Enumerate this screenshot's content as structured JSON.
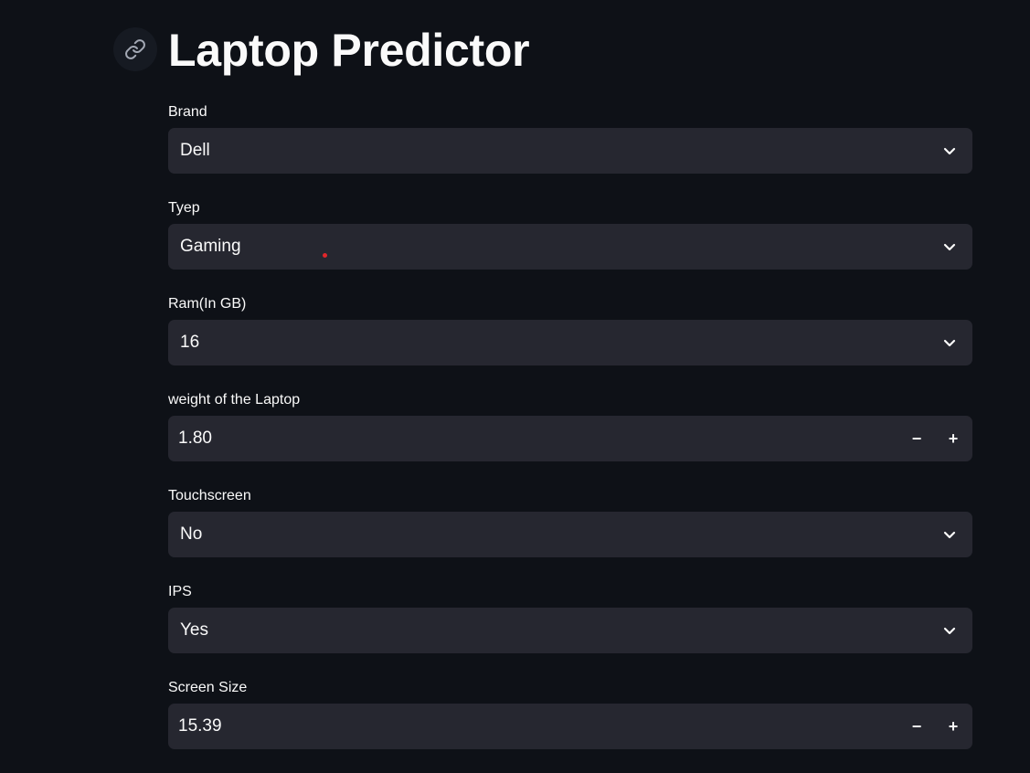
{
  "page": {
    "title": "Laptop Predictor",
    "anchor_icon": "link-icon"
  },
  "fields": {
    "brand": {
      "label": "Brand",
      "value": "Dell",
      "icon": "chevron-down-icon"
    },
    "type": {
      "label": "Tyep",
      "value": "Gaming",
      "icon": "chevron-down-icon"
    },
    "ram": {
      "label": "Ram(In GB)",
      "value": "16",
      "icon": "chevron-down-icon"
    },
    "weight": {
      "label": "weight of the Laptop",
      "value": "1.80",
      "minus": "−",
      "plus": "+"
    },
    "touchscreen": {
      "label": "Touchscreen",
      "value": "No",
      "icon": "chevron-down-icon"
    },
    "ips": {
      "label": "IPS",
      "value": "Yes",
      "icon": "chevron-down-icon"
    },
    "screen_size": {
      "label": "Screen Size",
      "value": "15.39",
      "minus": "−",
      "plus": "+"
    }
  },
  "colors": {
    "background": "#0e1117",
    "input_background": "#262730",
    "text": "#fafafa",
    "cursor": "#e0262a"
  }
}
